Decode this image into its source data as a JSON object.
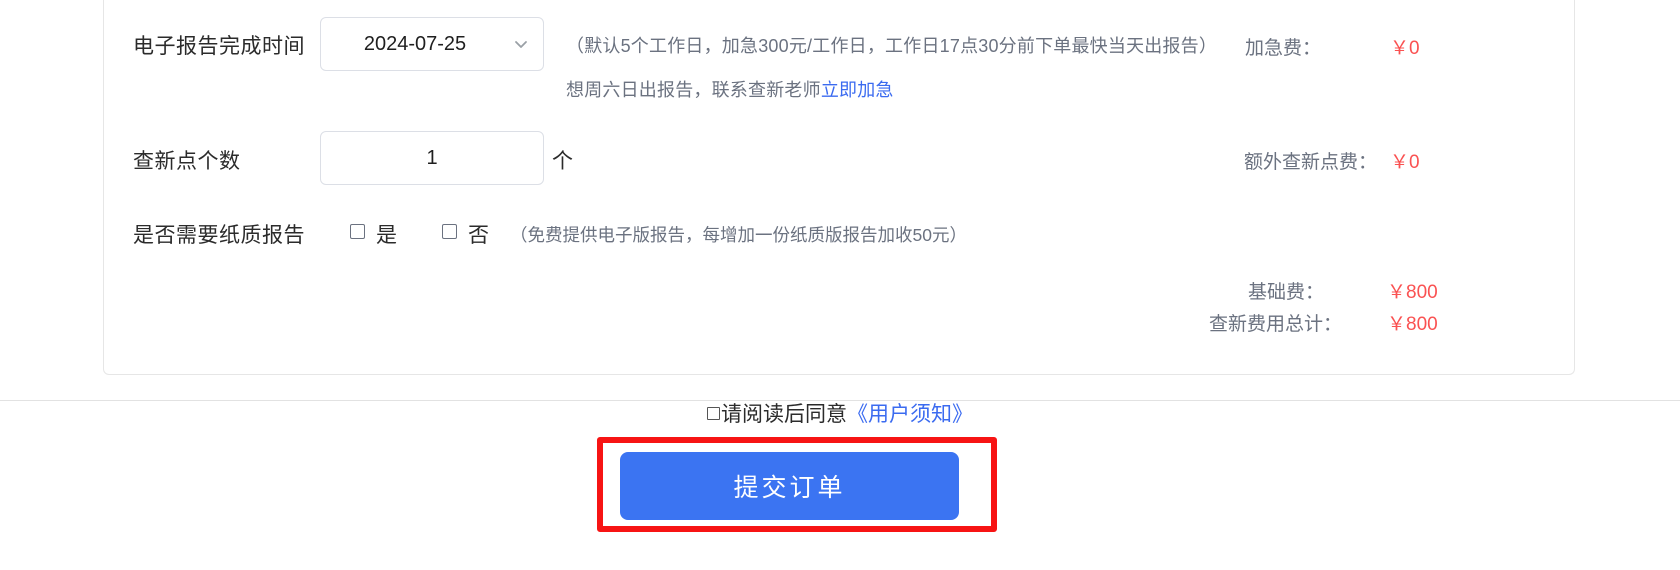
{
  "form": {
    "rows": [
      {
        "label": "电子报告完成时间",
        "select_value": "2024-07-25",
        "note_line1": "（默认5个工作日，加急300元/工作日，工作日17点30分前下单最快当天出报告）",
        "note_line2_prefix": "想周六日出报告，联系查新老师",
        "note_line2_link": "立即加急",
        "fee_label": "加急费：",
        "fee_value": "￥0"
      },
      {
        "label": "查新点个数",
        "input_value": "1",
        "unit": "个",
        "fee_label": "额外查新点费：",
        "fee_value": "￥0"
      },
      {
        "label": "是否需要纸质报告",
        "option_yes": "是",
        "option_no": "否",
        "note": "（免费提供电子版报告，每增加一份纸质版报告加收50元）"
      }
    ],
    "summary": [
      {
        "label": "基础费：",
        "value": "￥800"
      },
      {
        "label": "查新费用总计：",
        "value": "￥800"
      }
    ]
  },
  "footer": {
    "agreement_prefix": "请阅读后同意",
    "agreement_link": "《用户须知》",
    "submit_label": "提交订单"
  },
  "colors": {
    "accent": "#3b74f2",
    "price": "#fa5252",
    "link": "#3b6bf0",
    "highlight": "#f71414"
  }
}
